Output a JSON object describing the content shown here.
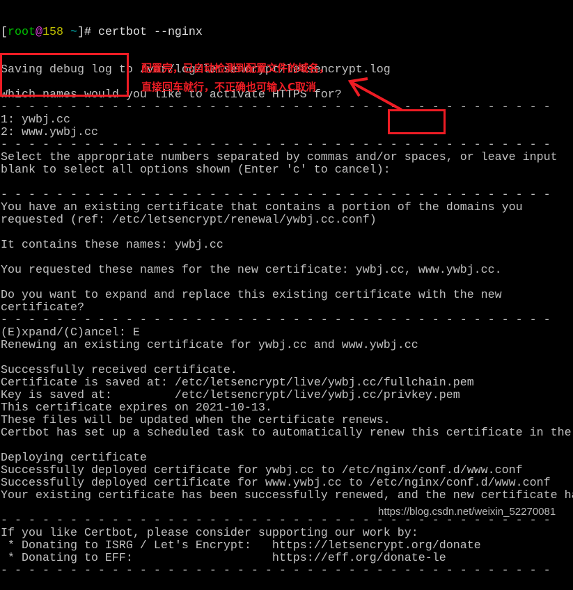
{
  "prompt": {
    "open": "[",
    "user": "root",
    "at": "@",
    "host": "158",
    "dir": " ~",
    "close": "]# ",
    "command": "certbot --nginx"
  },
  "lines": [
    "Saving debug log to /var/log/letsencrypt/letsencrypt.log",
    "",
    "Which names would you like to activate HTTPS for?",
    "- - - - - - - - - - - - - - - - - - - - - - - - - - - - - - - - - - - - - - - -",
    "1: ywbj.cc",
    "2: www.ywbj.cc",
    "- - - - - - - - - - - - - - - - - - - - - - - - - - - - - - - - - - - - - - - -",
    "Select the appropriate numbers separated by commas and/or spaces, or leave input",
    "blank to select all options shown (Enter 'c' to cancel):",
    "",
    "- - - - - - - - - - - - - - - - - - - - - - - - - - - - - - - - - - - - - - - -",
    "You have an existing certificate that contains a portion of the domains you",
    "requested (ref: /etc/letsencrypt/renewal/ywbj.cc.conf)",
    "",
    "It contains these names: ywbj.cc",
    "",
    "You requested these names for the new certificate: ywbj.cc, www.ywbj.cc.",
    "",
    "Do you want to expand and replace this existing certificate with the new",
    "certificate?",
    "- - - - - - - - - - - - - - - - - - - - - - - - - - - - - - - - - - - - - - - -",
    "(E)xpand/(C)ancel: E",
    "Renewing an existing certificate for ywbj.cc and www.ywbj.cc",
    "",
    "Successfully received certificate.",
    "Certificate is saved at: /etc/letsencrypt/live/ywbj.cc/fullchain.pem",
    "Key is saved at:         /etc/letsencrypt/live/ywbj.cc/privkey.pem",
    "This certificate expires on 2021-10-13.",
    "These files will be updated when the certificate renews.",
    "Certbot has set up a scheduled task to automatically renew this certificate in the",
    "",
    "Deploying certificate",
    "Successfully deployed certificate for ywbj.cc to /etc/nginx/conf.d/www.conf",
    "Successfully deployed certificate for www.ywbj.cc to /etc/nginx/conf.d/www.conf",
    "Your existing certificate has been successfully renewed, and the new certificate has",
    "",
    "- - - - - - - - - - - - - - - - - - - - - - - - - - - - - - - - - - - - - - - -",
    "If you like Certbot, please consider supporting our work by:",
    " * Donating to ISRG / Let's Encrypt:   https://letsencrypt.org/donate",
    " * Donating to EFF:                    https://eff.org/donate-le",
    "- - - - - - - - - - - - - - - - - - - - - - - - - - - - - - - - - - - - - - - -"
  ],
  "annotation": {
    "line1": "配置完，已自动检测到配置文件的域名，",
    "line2": "直接回车就行，不正确也可输入C取消",
    "color": "#ee1c24"
  },
  "watermark": "https://blog.csdn.net/weixin_52270081"
}
